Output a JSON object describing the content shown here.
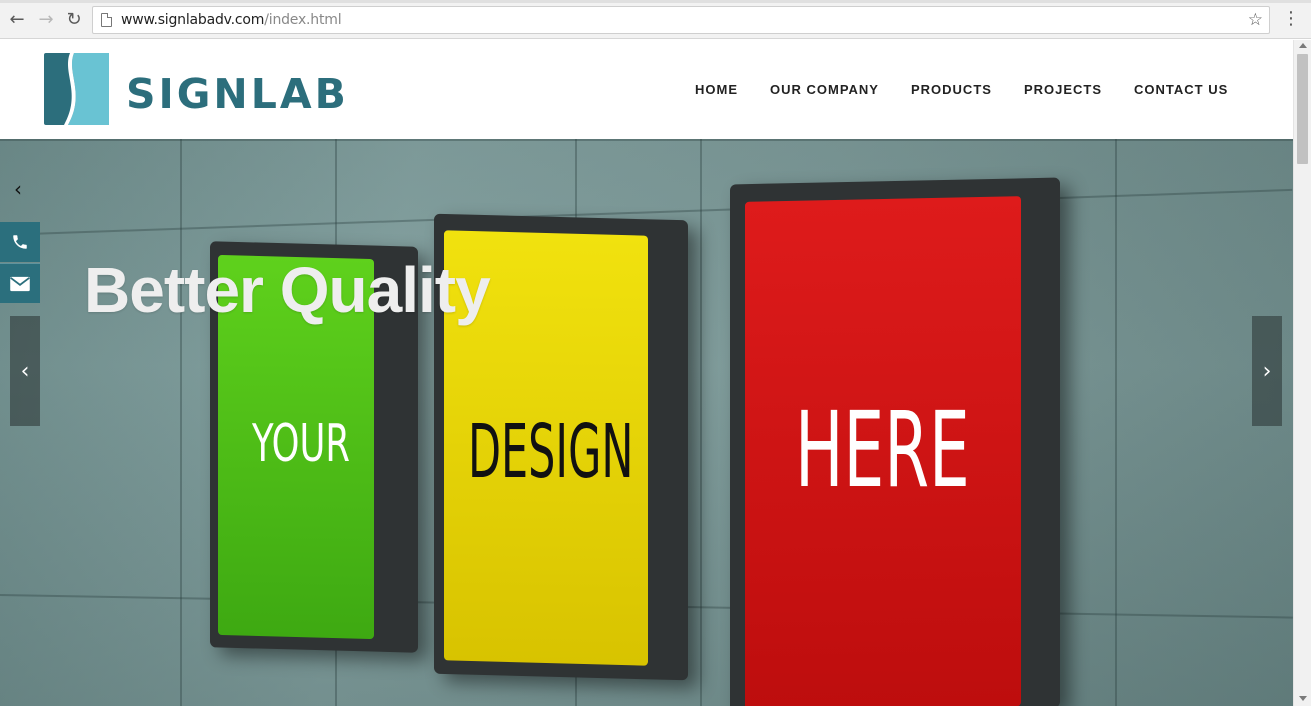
{
  "browser": {
    "url_domain": "www.signlabadv.com",
    "url_path": "/index.html",
    "back_icon": "arrow-left-icon",
    "forward_icon": "arrow-right-icon",
    "reload_icon": "reload-icon",
    "bookmark_icon": "star-icon",
    "menu_icon": "kebab-menu-icon"
  },
  "header": {
    "logo_text": "SIGNLAB",
    "brand_color": "#2c6e7c",
    "nav": [
      {
        "label": "HOME"
      },
      {
        "label": "OUR COMPANY"
      },
      {
        "label": "PRODUCTS"
      },
      {
        "label": "PROJECTS"
      },
      {
        "label": "CONTACT US"
      }
    ]
  },
  "hero": {
    "title": "Better Quality",
    "signs": [
      {
        "text": "YOUR",
        "color": "#4cc21a",
        "text_color": "#ffffff"
      },
      {
        "text": "DESIGN",
        "color": "#f0dc0a",
        "text_color": "#111111"
      },
      {
        "text": "HERE",
        "color": "#d91a1a",
        "text_color": "#ffffff"
      }
    ],
    "side_buttons": [
      {
        "icon": "phone-icon"
      },
      {
        "icon": "envelope-icon"
      }
    ],
    "prev_arrow": "‹",
    "next_arrow": "›",
    "small_back_arrow": "‹"
  }
}
